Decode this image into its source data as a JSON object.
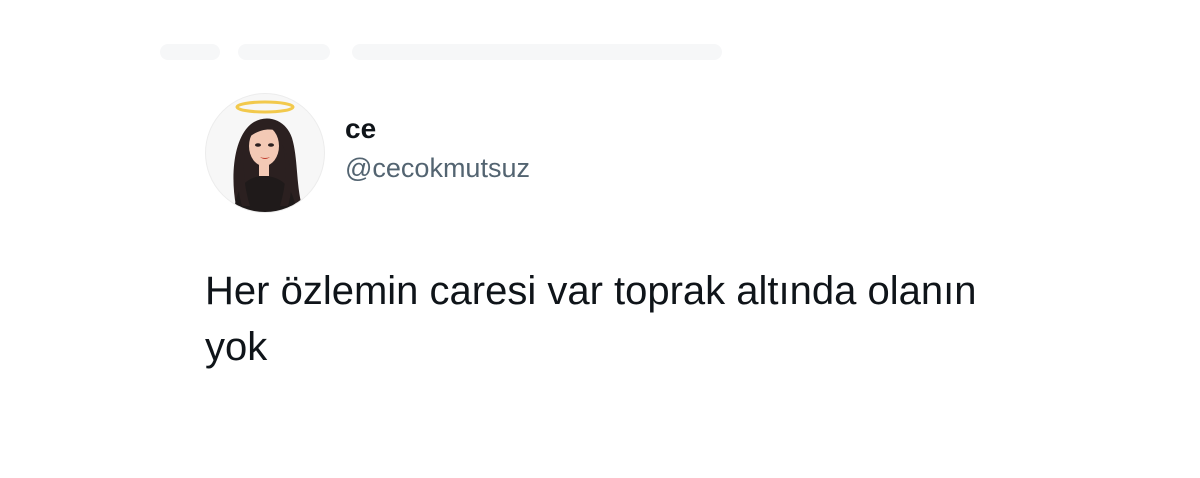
{
  "tweet": {
    "author": {
      "name": "ce",
      "handle": "@cecokmutsuz"
    },
    "text": "Her özlemin caresi var toprak altında olanın yok"
  },
  "colors": {
    "background": "#ffffff",
    "text_primary": "#0f1419",
    "text_secondary": "#536471",
    "halo": "#f2c94c"
  },
  "icons": {
    "avatar": "halo-woman-avatar-icon"
  }
}
